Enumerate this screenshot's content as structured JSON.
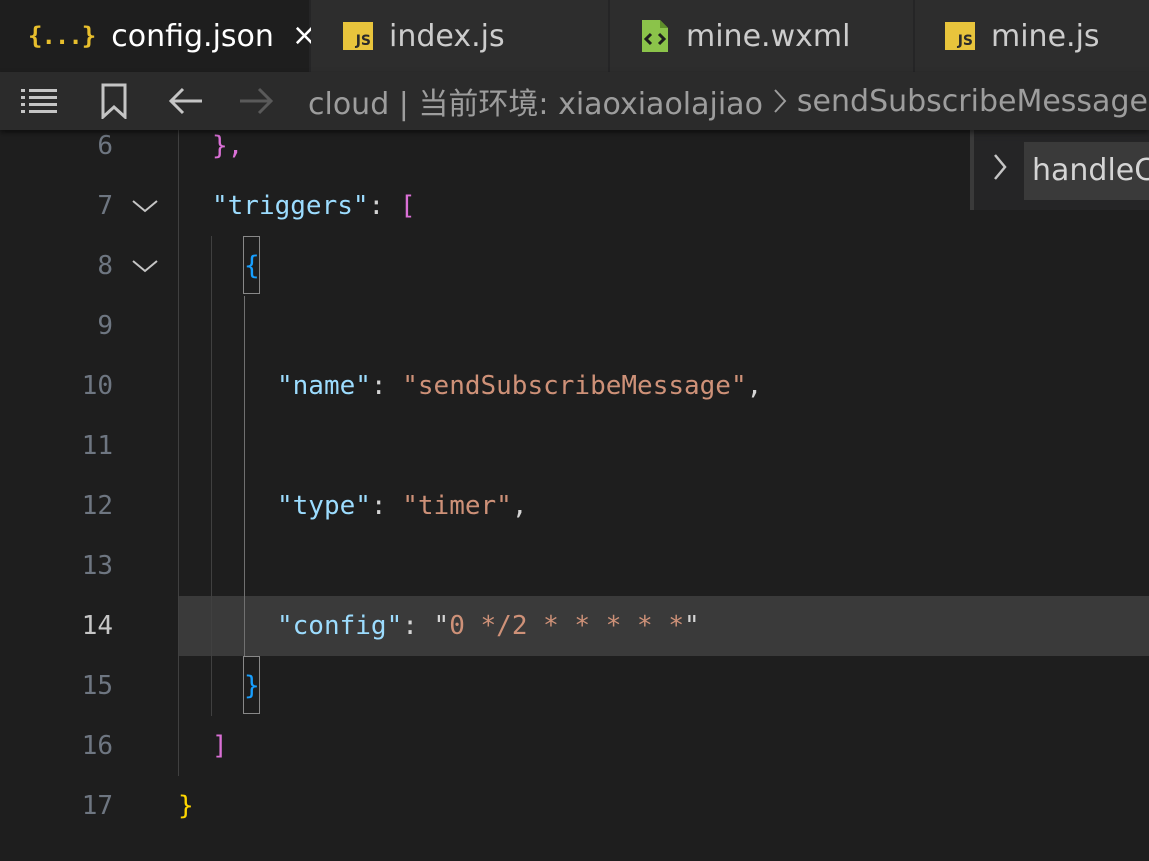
{
  "tabs": [
    {
      "label": "config.json",
      "icon": "json-file-icon",
      "active": true,
      "close": "×"
    },
    {
      "label": "index.js",
      "icon": "js-file-icon",
      "active": false
    },
    {
      "label": "mine.wxml",
      "icon": "wxml-file-icon",
      "active": false
    },
    {
      "label": "mine.js",
      "icon": "js-file-icon",
      "active": false
    }
  ],
  "icons": {
    "json_tab": "{...}",
    "js_tab": "JS"
  },
  "breadcrumb": {
    "path": "cloud | 当前环境: xiaoxiaolajiao",
    "symbol": "sendSubscribeMessage"
  },
  "sticky_scroll": {
    "label": "handleC"
  },
  "editor": {
    "current_line": "14",
    "lines": [
      {
        "num": "6",
        "text": "},"
      },
      {
        "num": "7",
        "key": "\"triggers\"",
        "colon": ": ",
        "bracket": "["
      },
      {
        "num": "8",
        "text": "{"
      },
      {
        "num": "9",
        "text": ""
      },
      {
        "num": "10",
        "key": "\"name\"",
        "colon": ": ",
        "value": "\"sendSubscribeMessage\"",
        "comma": ","
      },
      {
        "num": "11",
        "text": ""
      },
      {
        "num": "12",
        "key": "\"type\"",
        "colon": ": ",
        "value": "\"timer\"",
        "comma": ","
      },
      {
        "num": "13",
        "text": ""
      },
      {
        "num": "14",
        "key": "\"config\"",
        "colon": ": ",
        "quote_open": "\"",
        "value": "0 */2 * * * * *",
        "quote_close": "\""
      },
      {
        "num": "15",
        "text": "}"
      },
      {
        "num": "16",
        "text": "]"
      },
      {
        "num": "17",
        "text": "}"
      }
    ]
  },
  "colors": {
    "editor_bg": "#1e1e1e",
    "key": "#9cdcfe",
    "string": "#ce9178",
    "bracket_gold": "#ffd700",
    "bracket_purple": "#da70d6",
    "bracket_blue": "#179fff"
  }
}
